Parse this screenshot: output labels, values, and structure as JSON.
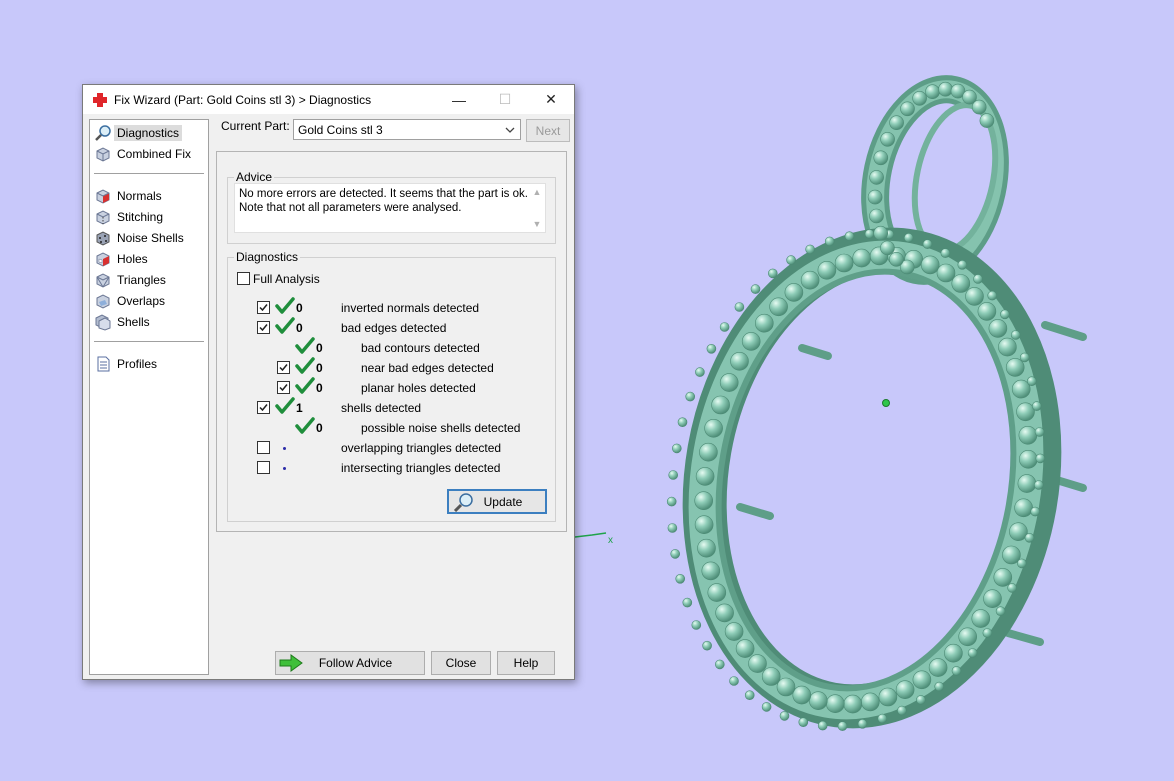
{
  "window": {
    "title": "Fix Wizard (Part: Gold Coins stl 3) > Diagnostics",
    "minimize_glyph": "—",
    "maximize_glyph": "☐",
    "close_glyph": "✕"
  },
  "sidebar": {
    "items": [
      {
        "label": "Diagnostics",
        "icon": "magnifier-icon"
      },
      {
        "label": "Combined Fix",
        "icon": "cube-icon"
      },
      {
        "label": "Normals",
        "icon": "cube-red-face-icon"
      },
      {
        "label": "Stitching",
        "icon": "cube-stitch-icon"
      },
      {
        "label": "Noise Shells",
        "icon": "noise-cube-icon"
      },
      {
        "label": "Holes",
        "icon": "cube-hole-icon"
      },
      {
        "label": "Triangles",
        "icon": "triangle-cube-icon"
      },
      {
        "label": "Overlaps",
        "icon": "overlap-cube-icon"
      },
      {
        "label": "Shells",
        "icon": "shells-cube-icon"
      },
      {
        "label": "Profiles",
        "icon": "document-icon"
      }
    ]
  },
  "header": {
    "current_part_label": "Current Part:",
    "current_part_value": "Gold Coins stl 3",
    "next_label": "Next"
  },
  "advice": {
    "title": "Advice",
    "line1": "No more errors are detected. It seems that the part is ok.",
    "line2": "Note that not all parameters were analysed."
  },
  "diagnostics": {
    "title": "Diagnostics",
    "full_analysis_label": "Full Analysis",
    "rows": [
      {
        "checked": true,
        "status": "ok",
        "count": "0",
        "label": "inverted normals detected"
      },
      {
        "checked": true,
        "status": "ok",
        "count": "0",
        "label": "bad edges detected"
      },
      {
        "checked": null,
        "status": "ok",
        "count": "0",
        "label": "bad contours detected"
      },
      {
        "checked": true,
        "status": "ok",
        "count": "0",
        "label": "near bad edges detected"
      },
      {
        "checked": true,
        "status": "ok",
        "count": "0",
        "label": "planar holes detected"
      },
      {
        "checked": true,
        "status": "ok",
        "count": "1",
        "label": "shells detected"
      },
      {
        "checked": null,
        "status": "ok",
        "count": "0",
        "label": "possible noise shells detected"
      },
      {
        "checked": false,
        "status": "none",
        "count": "",
        "label": "overlapping triangles detected"
      },
      {
        "checked": false,
        "status": "none",
        "count": "",
        "label": "intersecting triangles detected"
      }
    ],
    "update_label": "Update"
  },
  "footer": {
    "follow_advice_label": "Follow Advice",
    "close_label": "Close",
    "help_label": "Help"
  },
  "scene": {
    "axis_label": "x",
    "background_color": "#c8c8fa",
    "model_color": "#86c4b0"
  }
}
